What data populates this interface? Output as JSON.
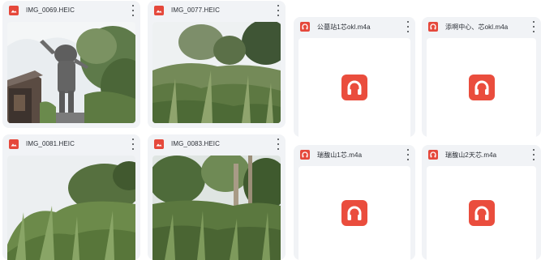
{
  "images": [
    {
      "name": "IMG_0069.HEIC",
      "type_icon": "image-file-icon",
      "scene": "statue"
    },
    {
      "name": "IMG_0077.HEIC",
      "type_icon": "image-file-icon",
      "scene": "bushes"
    },
    {
      "name": "IMG_0081.HEIC",
      "type_icon": "image-file-icon",
      "scene": "grass"
    },
    {
      "name": "IMG_0083.HEIC",
      "type_icon": "image-file-icon",
      "scene": "forest"
    }
  ],
  "audio": [
    {
      "name": "公墓站1芯okl.m4a",
      "type_icon": "audio-file-icon",
      "preview_icon": "headphones-icon"
    },
    {
      "name": "添啊中心、芯okl.m4a",
      "type_icon": "audio-file-icon",
      "preview_icon": "headphones-icon"
    },
    {
      "name": "瑞馥山1芯.m4a",
      "type_icon": "audio-file-icon",
      "preview_icon": "headphones-icon"
    },
    {
      "name": "瑞馥山2天芯.m4a",
      "type_icon": "audio-file-icon",
      "preview_icon": "headphones-icon"
    }
  ],
  "colors": {
    "card_bg": "#f1f3f6",
    "file_icon_red": "#e5483b",
    "audio_tile_red": "#ea4d3d"
  }
}
